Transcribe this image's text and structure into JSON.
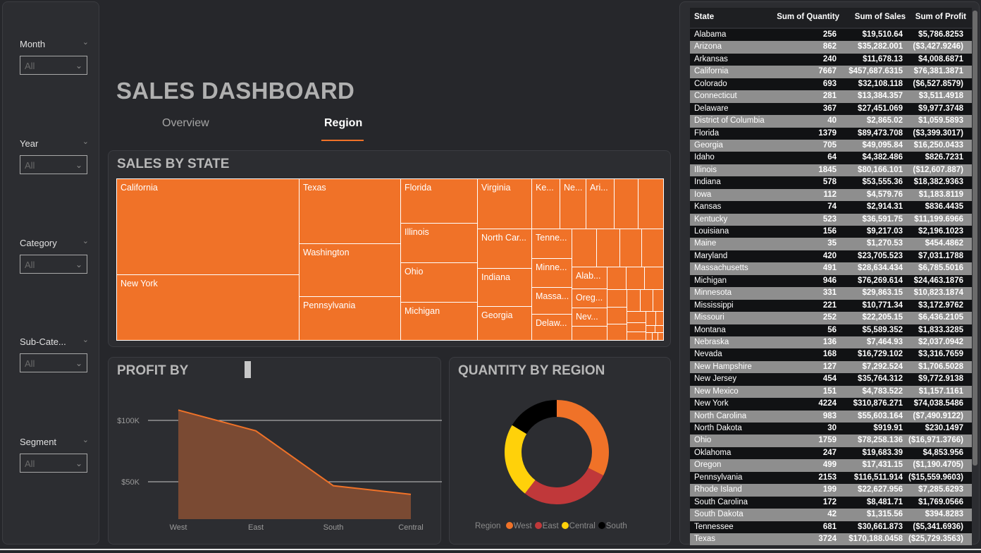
{
  "slicers": [
    {
      "label": "Month",
      "value": "All"
    },
    {
      "label": "Year",
      "value": "All"
    },
    {
      "label": "Category",
      "value": "All"
    },
    {
      "label": "Sub-Cate...",
      "value": "All"
    },
    {
      "label": "Segment",
      "value": "All"
    }
  ],
  "title": "SALES DASHBOARD",
  "tabs": {
    "overview": "Overview",
    "region": "Region"
  },
  "treemap": {
    "title": "SALES BY STATE",
    "labels": {
      "california": "California",
      "new_york": "New York",
      "texas": "Texas",
      "washington": "Washington",
      "pennsylvania": "Pennsylvania",
      "florida": "Florida",
      "illinois": "Illinois",
      "ohio": "Ohio",
      "michigan": "Michigan",
      "virginia": "Virginia",
      "north_carolina": "North Car...",
      "indiana": "Indiana",
      "georgia": "Georgia",
      "kentucky": "Ke...",
      "nebraska": "Ne...",
      "arizona": "Ari...",
      "tennessee": "Tenne...",
      "minnesota": "Minne...",
      "massachusetts": "Massa...",
      "delaware": "Delaw...",
      "alabama": "Alab...",
      "oregon": "Oreg...",
      "nevada": "Nev..."
    }
  },
  "profit_chart": {
    "title": "PROFIT BY",
    "ytick_labels": [
      "$100K",
      "$50K"
    ],
    "categories": [
      "West",
      "East",
      "South",
      "Central"
    ],
    "color": "#f07228"
  },
  "quantity_chart": {
    "title": "QUANTITY BY REGION",
    "legend_title": "Region"
  },
  "chart_data": [
    {
      "type": "area",
      "title": "PROFIT BY",
      "categories": [
        "West",
        "East",
        "South",
        "Central"
      ],
      "values": [
        108418,
        91523,
        46749,
        39706
      ],
      "yticks": [
        50000,
        100000
      ],
      "ylim": [
        0,
        120000
      ],
      "grid": true
    },
    {
      "type": "pie",
      "title": "QUANTITY BY REGION",
      "categories": [
        "West",
        "East",
        "Central",
        "South"
      ],
      "values": [
        12266,
        10618,
        8780,
        6209
      ],
      "colors": [
        "#f07228",
        "#c0383a",
        "#ffd10a",
        "#000000"
      ],
      "legend": "bottom"
    }
  ],
  "table": {
    "headers": [
      "State",
      "Sum of Quantity",
      "Sum of Sales",
      "Sum of Profit"
    ],
    "rows": [
      [
        "Alabama",
        "256",
        "$19,510.64",
        "$5,786.8253"
      ],
      [
        "Arizona",
        "862",
        "$35,282.001",
        "($3,427.9246)"
      ],
      [
        "Arkansas",
        "240",
        "$11,678.13",
        "$4,008.6871"
      ],
      [
        "California",
        "7667",
        "$457,687.6315",
        "$76,381.3871"
      ],
      [
        "Colorado",
        "693",
        "$32,108.118",
        "($6,527.8579)"
      ],
      [
        "Connecticut",
        "281",
        "$13,384.357",
        "$3,511.4918"
      ],
      [
        "Delaware",
        "367",
        "$27,451.069",
        "$9,977.3748"
      ],
      [
        "District of Columbia",
        "40",
        "$2,865.02",
        "$1,059.5893"
      ],
      [
        "Florida",
        "1379",
        "$89,473.708",
        "($3,399.3017)"
      ],
      [
        "Georgia",
        "705",
        "$49,095.84",
        "$16,250.0433"
      ],
      [
        "Idaho",
        "64",
        "$4,382.486",
        "$826.7231"
      ],
      [
        "Illinois",
        "1845",
        "$80,166.101",
        "($12,607.887)"
      ],
      [
        "Indiana",
        "578",
        "$53,555.36",
        "$18,382.9363"
      ],
      [
        "Iowa",
        "112",
        "$4,579.76",
        "$1,183.8119"
      ],
      [
        "Kansas",
        "74",
        "$2,914.31",
        "$836.4435"
      ],
      [
        "Kentucky",
        "523",
        "$36,591.75",
        "$11,199.6966"
      ],
      [
        "Louisiana",
        "156",
        "$9,217.03",
        "$2,196.1023"
      ],
      [
        "Maine",
        "35",
        "$1,270.53",
        "$454.4862"
      ],
      [
        "Maryland",
        "420",
        "$23,705.523",
        "$7,031.1788"
      ],
      [
        "Massachusetts",
        "491",
        "$28,634.434",
        "$6,785.5016"
      ],
      [
        "Michigan",
        "946",
        "$76,269.614",
        "$24,463.1876"
      ],
      [
        "Minnesota",
        "331",
        "$29,863.15",
        "$10,823.1874"
      ],
      [
        "Mississippi",
        "221",
        "$10,771.34",
        "$3,172.9762"
      ],
      [
        "Missouri",
        "252",
        "$22,205.15",
        "$6,436.2105"
      ],
      [
        "Montana",
        "56",
        "$5,589.352",
        "$1,833.3285"
      ],
      [
        "Nebraska",
        "136",
        "$7,464.93",
        "$2,037.0942"
      ],
      [
        "Nevada",
        "168",
        "$16,729.102",
        "$3,316.7659"
      ],
      [
        "New Hampshire",
        "127",
        "$7,292.524",
        "$1,706.5028"
      ],
      [
        "New Jersey",
        "454",
        "$35,764.312",
        "$9,772.9138"
      ],
      [
        "New Mexico",
        "151",
        "$4,783.522",
        "$1,157.1161"
      ],
      [
        "New York",
        "4224",
        "$310,876.271",
        "$74,038.5486"
      ],
      [
        "North Carolina",
        "983",
        "$55,603.164",
        "($7,490.9122)"
      ],
      [
        "North Dakota",
        "30",
        "$919.91",
        "$230.1497"
      ],
      [
        "Ohio",
        "1759",
        "$78,258.136",
        "($16,971.3766)"
      ],
      [
        "Oklahoma",
        "247",
        "$19,683.39",
        "$4,853.956"
      ],
      [
        "Oregon",
        "499",
        "$17,431.15",
        "($1,190.4705)"
      ],
      [
        "Pennsylvania",
        "2153",
        "$116,511.914",
        "($15,559.9603)"
      ],
      [
        "Rhode Island",
        "199",
        "$22,627.956",
        "$7,285.6293"
      ],
      [
        "South Carolina",
        "172",
        "$8,481.71",
        "$1,769.0566"
      ],
      [
        "South Dakota",
        "42",
        "$1,315.56",
        "$394.8283"
      ],
      [
        "Tennessee",
        "681",
        "$30,661.873",
        "($5,341.6936)"
      ],
      [
        "Texas",
        "3724",
        "$170,188.0458",
        "($25,729.3563)"
      ]
    ]
  }
}
